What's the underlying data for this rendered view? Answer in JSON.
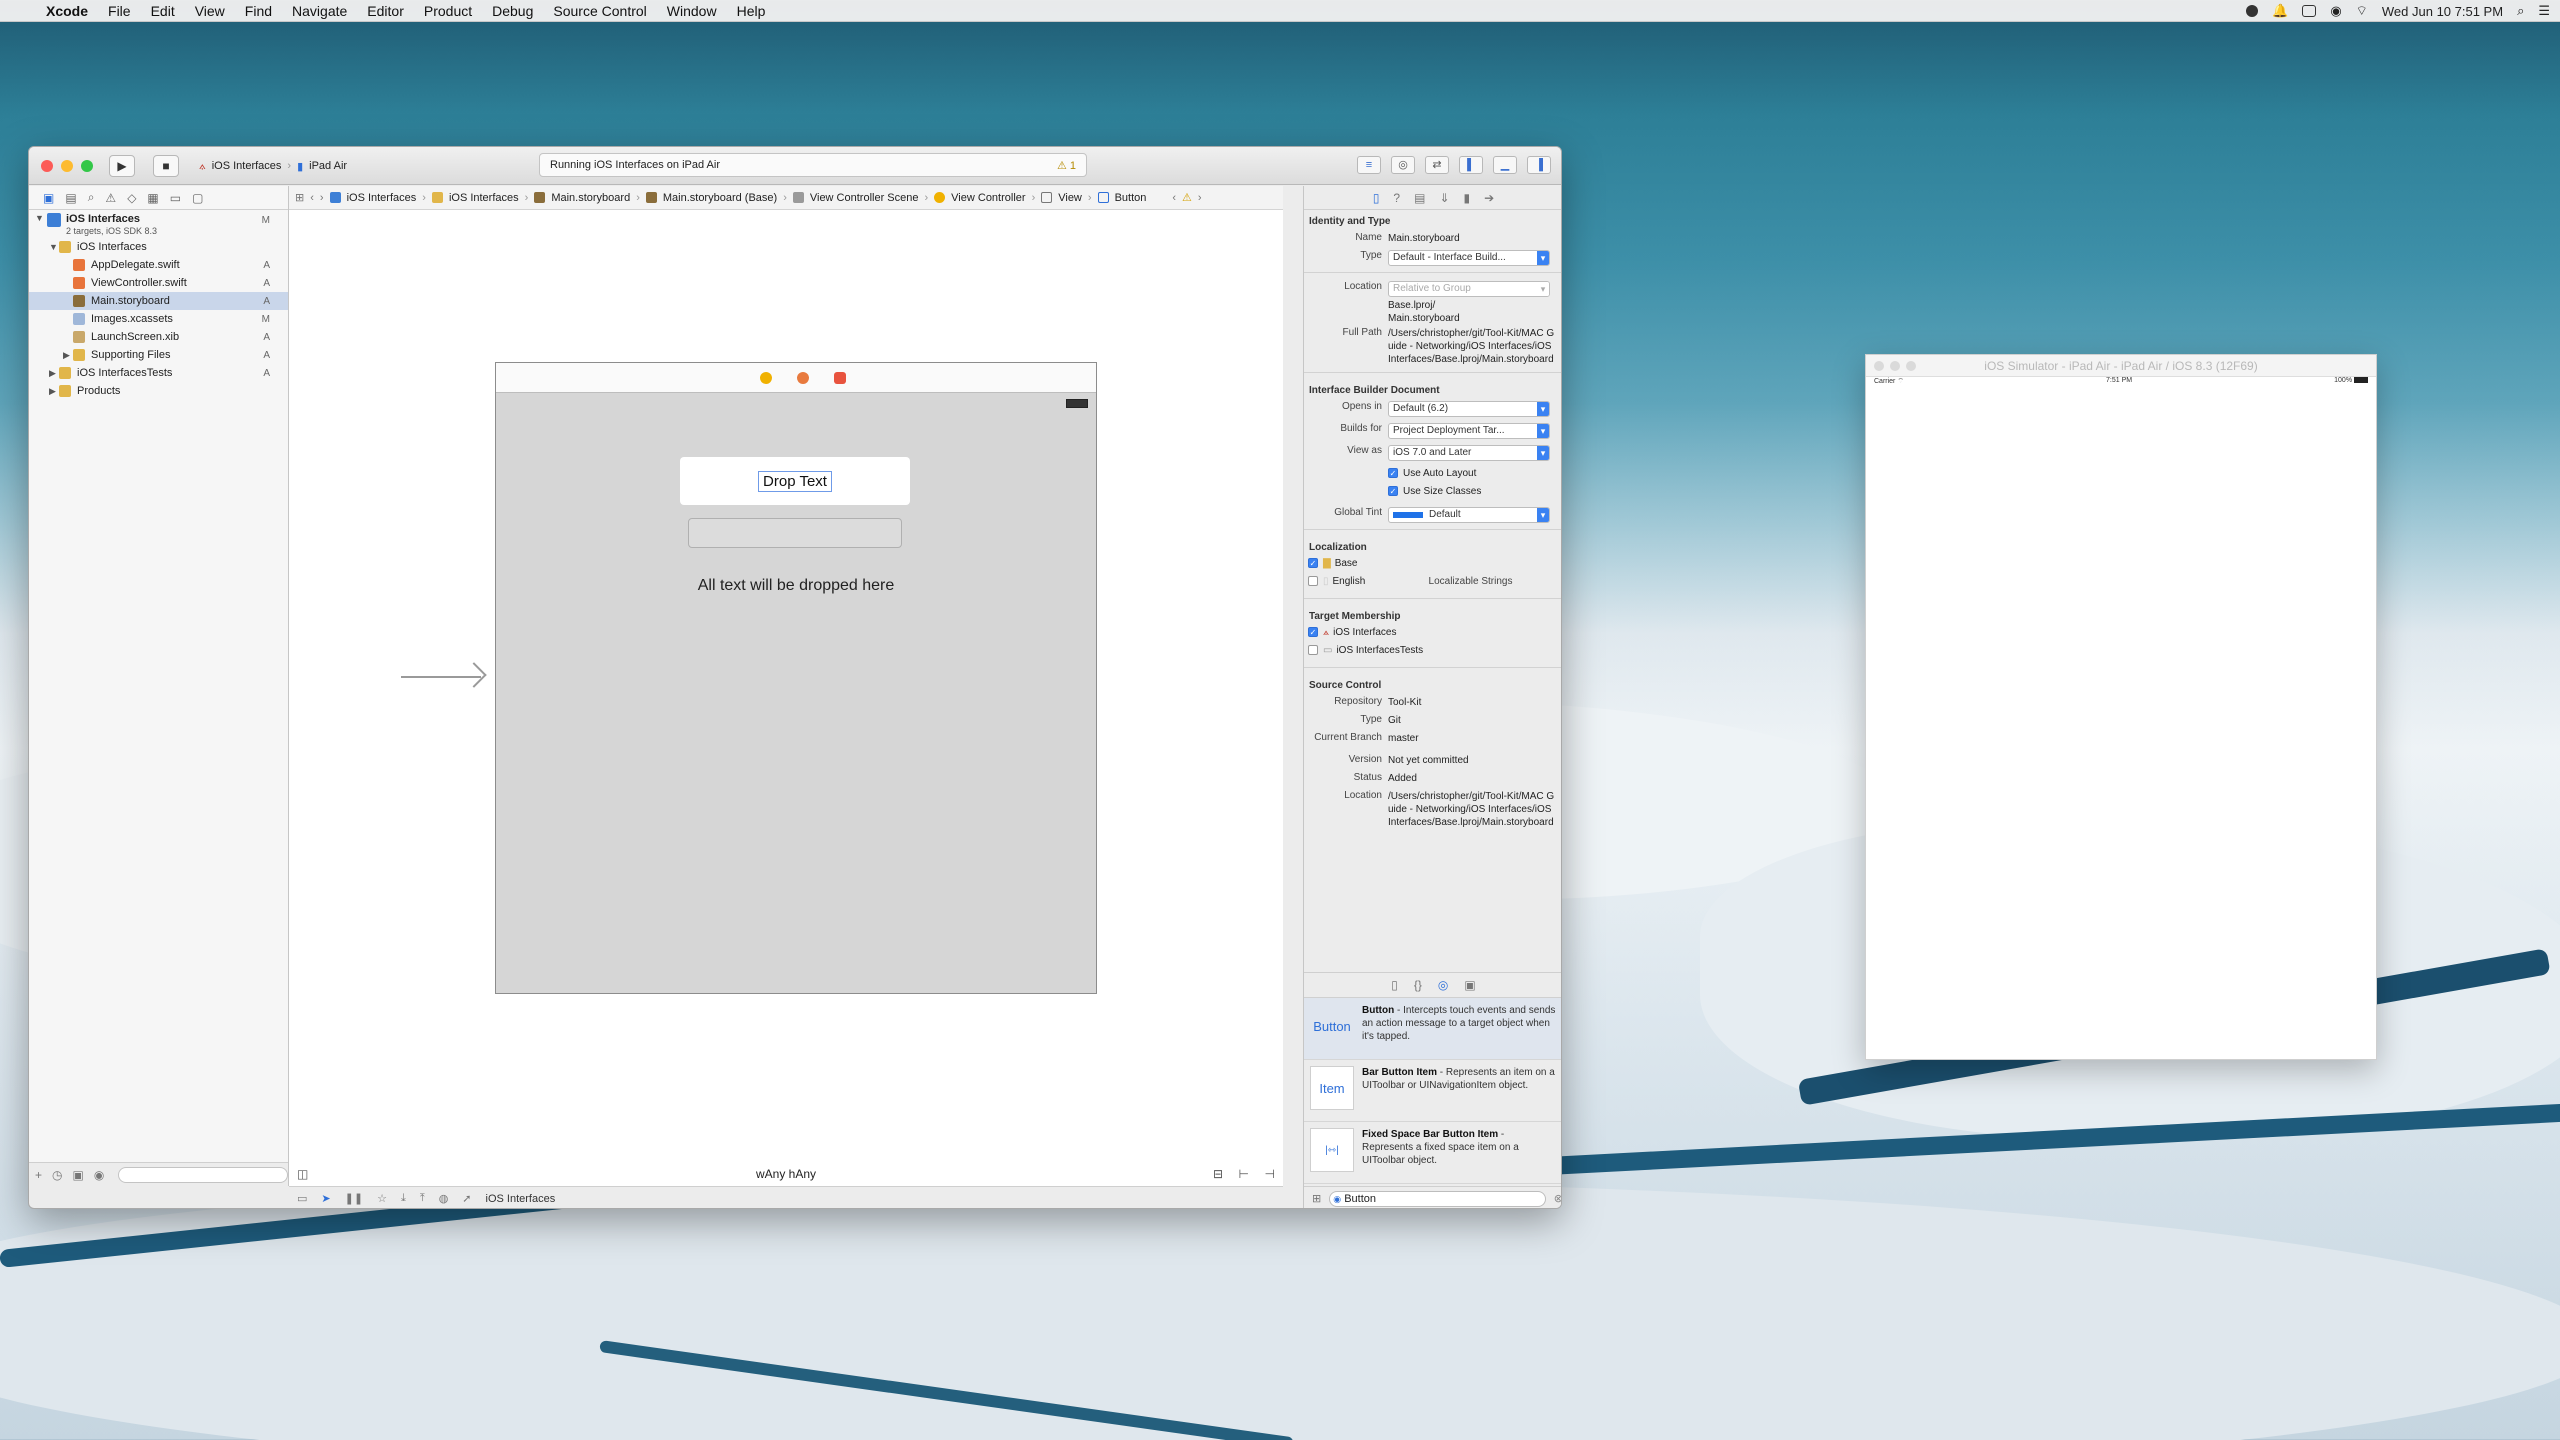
{
  "menubar": {
    "app": "Xcode",
    "items": [
      "File",
      "Edit",
      "View",
      "Find",
      "Navigate",
      "Editor",
      "Product",
      "Debug",
      "Source Control",
      "Window",
      "Help"
    ],
    "clock": "Wed Jun 10  7:51 PM"
  },
  "toolbar": {
    "scheme": "iOS Interfaces",
    "device": "iPad Air",
    "activity": "Running iOS Interfaces on iPad Air",
    "warnings": "1"
  },
  "navigator": {
    "project": "iOS Interfaces",
    "project_sub": "2 targets, iOS SDK 8.3",
    "project_status": "M",
    "items": [
      {
        "label": "iOS Interfaces",
        "status": "",
        "indent": 1,
        "kind": "folder",
        "open": true
      },
      {
        "label": "AppDelegate.swift",
        "status": "A",
        "indent": 2,
        "kind": "swift"
      },
      {
        "label": "ViewController.swift",
        "status": "A",
        "indent": 2,
        "kind": "swift"
      },
      {
        "label": "Main.storyboard",
        "status": "A",
        "indent": 2,
        "kind": "storyboard",
        "selected": true
      },
      {
        "label": "Images.xcassets",
        "status": "M",
        "indent": 2,
        "kind": "assets"
      },
      {
        "label": "LaunchScreen.xib",
        "status": "A",
        "indent": 2,
        "kind": "xib"
      },
      {
        "label": "Supporting Files",
        "status": "A",
        "indent": 2,
        "kind": "folder"
      },
      {
        "label": "iOS InterfacesTests",
        "status": "A",
        "indent": 1,
        "kind": "folder"
      },
      {
        "label": "Products",
        "status": "",
        "indent": 1,
        "kind": "folder"
      }
    ]
  },
  "jumpbar": [
    "iOS Interfaces",
    "iOS Interfaces",
    "Main.storyboard",
    "Main.storyboard (Base)",
    "View Controller Scene",
    "View Controller",
    "View",
    "Button"
  ],
  "scene": {
    "button_label": "Drop Text",
    "label_text": "All text will be dropped here"
  },
  "canvas": {
    "size_class": "wAny hAny"
  },
  "debug": {
    "target": "iOS Interfaces"
  },
  "inspector": {
    "identity": {
      "title": "Identity and Type",
      "name_label": "Name",
      "name": "Main.storyboard",
      "type_label": "Type",
      "type": "Default - Interface Build...",
      "location_label": "Location",
      "location": "Relative to Group",
      "location_path": "Base.lproj/\nMain.storyboard",
      "fullpath_label": "Full Path",
      "fullpath": "/Users/christopher/git/Tool-Kit/MAC Guide - Networking/iOS Interfaces/iOS Interfaces/Base.lproj/Main.storyboard"
    },
    "ibdoc": {
      "title": "Interface Builder Document",
      "opens_label": "Opens in",
      "opens": "Default (6.2)",
      "builds_label": "Builds for",
      "builds": "Project Deployment Tar...",
      "viewas_label": "View as",
      "viewas": "iOS 7.0 and Later",
      "autolayout": "Use Auto Layout",
      "sizeclasses": "Use Size Classes",
      "tint_label": "Global Tint",
      "tint": "Default",
      "tint_color": "#1f72e8"
    },
    "localization": {
      "title": "Localization",
      "base": "Base",
      "english": "English",
      "english_type": "Localizable Strings"
    },
    "target": {
      "title": "Target Membership",
      "t1": "iOS Interfaces",
      "t2": "iOS InterfacesTests"
    },
    "source": {
      "title": "Source Control",
      "repo_label": "Repository",
      "repo": "Tool-Kit",
      "type_label": "Type",
      "type": "Git",
      "branch_label": "Current Branch",
      "branch": "master",
      "version_label": "Version",
      "version": "Not yet committed",
      "status_label": "Status",
      "status": "Added",
      "loc_label": "Location",
      "loc": "/Users/christopher/git/Tool-Kit/MAC Guide - Networking/iOS Interfaces/iOS Interfaces/Base.lproj/Main.storyboard"
    },
    "library": {
      "items": [
        {
          "thumb": "Button",
          "name": "Button",
          "desc": " - Intercepts touch events and sends an action message to a target object when it's tapped."
        },
        {
          "thumb": "Item",
          "name": "Bar Button Item",
          "desc": " - Represents an item on a UIToolbar or UINavigationItem object."
        },
        {
          "thumb": "",
          "name": "Fixed Space Bar Button Item",
          "desc": " - Represents a fixed space item on a UIToolbar object."
        }
      ],
      "filter": "Button"
    }
  },
  "simulator": {
    "title": "iOS Simulator - iPad Air - iPad Air / iOS 8.3 (12F69)",
    "carrier": "Carrier",
    "time": "7:51 PM",
    "battery": "100%"
  }
}
